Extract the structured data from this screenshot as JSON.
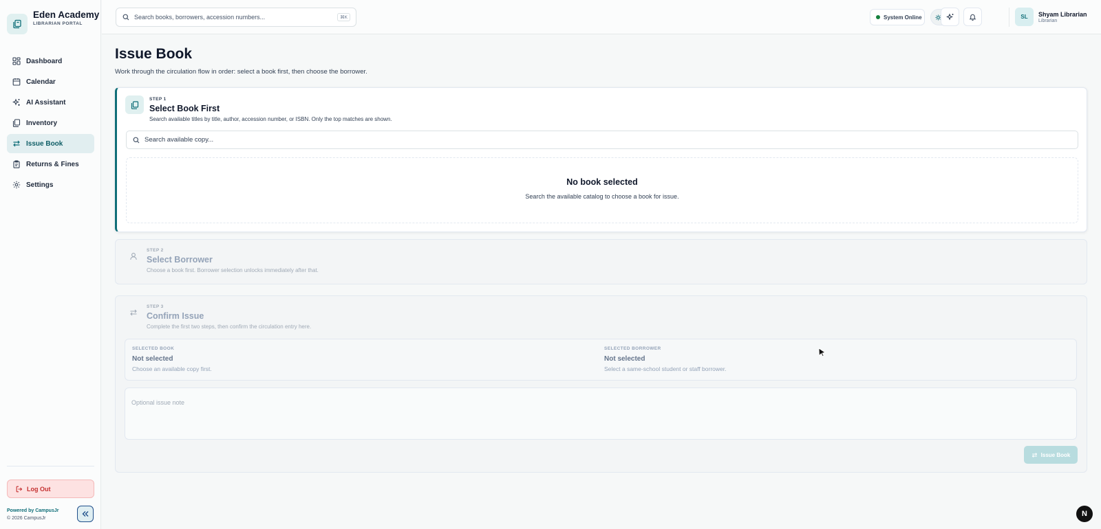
{
  "brand": {
    "name": "Eden Academy",
    "portal": "LIBRARIAN PORTAL"
  },
  "sidebar": {
    "items": [
      {
        "label": "Dashboard",
        "icon": "dashboard-icon"
      },
      {
        "label": "Calendar",
        "icon": "calendar-icon"
      },
      {
        "label": "AI Assistant",
        "icon": "sparkles-icon"
      },
      {
        "label": "Inventory",
        "icon": "books-icon"
      },
      {
        "label": "Issue Book",
        "icon": "transfer-icon",
        "active": true
      },
      {
        "label": "Returns & Fines",
        "icon": "clipboard-icon"
      },
      {
        "label": "Settings",
        "icon": "gear-icon"
      }
    ],
    "logout_label": "Log Out",
    "powered_by": "Powered by CampusJr",
    "copyright": "© 2026 CampusJr"
  },
  "topbar": {
    "search_placeholder": "Search books, borrowers, accession numbers...",
    "shortcut": "⌘K",
    "status": "System Online",
    "user": {
      "initials": "SL",
      "name": "Shyam Librarian",
      "role": "Librarian"
    }
  },
  "page": {
    "title": "Issue Book",
    "subtitle": "Work through the circulation flow in order: select a book first, then choose the borrower."
  },
  "step1": {
    "label": "STEP 1",
    "title": "Select Book First",
    "desc": "Search available titles by title, author, accession number, or ISBN. Only the top matches are shown.",
    "search_placeholder": "Search available copy...",
    "empty_title": "No book selected",
    "empty_desc": "Search the available catalog to choose a book for issue."
  },
  "step2": {
    "label": "STEP 2",
    "title": "Select Borrower",
    "desc": "Choose a book first. Borrower selection unlocks immediately after that."
  },
  "step3": {
    "label": "STEP 3",
    "title": "Confirm Issue",
    "desc": "Complete the first two steps, then confirm the circulation entry here.",
    "book_label": "SELECTED BOOK",
    "book_value": "Not selected",
    "book_hint": "Choose an available copy first.",
    "borrower_label": "SELECTED BORROWER",
    "borrower_value": "Not selected",
    "borrower_hint": "Select a same-school student or staff borrower.",
    "note_placeholder": "Optional issue note",
    "button_label": "Issue Book"
  },
  "badge": "N",
  "colors": {
    "accent": "#0f6e78",
    "status_ok": "#15803d",
    "danger": "#c53030"
  }
}
